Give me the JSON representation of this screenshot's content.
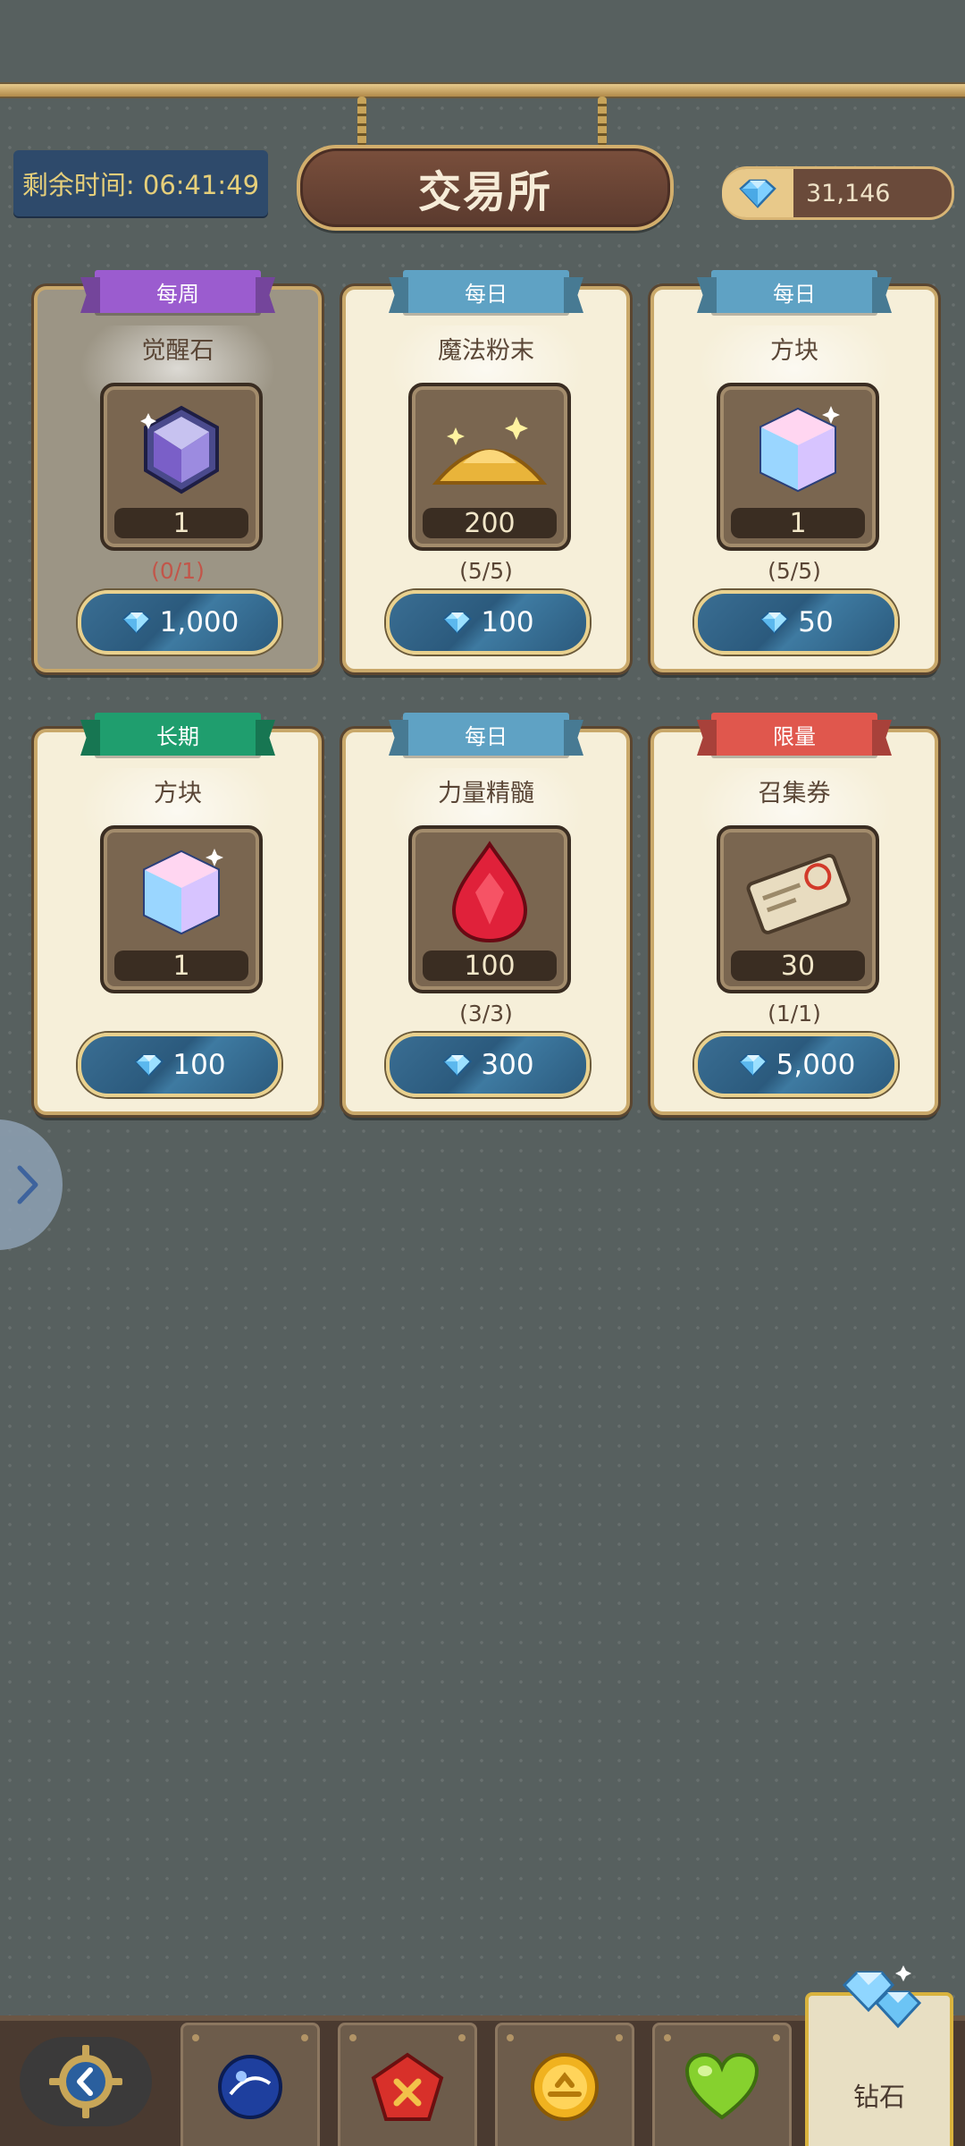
{
  "header": {
    "timer_text": "剩余时间: 06:41:49",
    "title": "交易所",
    "currency_value": "31,146",
    "currency_icon": "diamond-icon"
  },
  "colors": {
    "ribbon_weekly": "#9b5ccf",
    "ribbon_daily": "#5fa2c4",
    "ribbon_long": "#1f9e6e",
    "ribbon_limited": "#e0574d"
  },
  "cards": [
    {
      "ribbon": "每周",
      "ribbon_color": "#9b5ccf",
      "name": "觉醒石",
      "qty": "1",
      "limit": "(0/1)",
      "price": "1,000",
      "icon": "awakening-stone-icon",
      "sold_out": true
    },
    {
      "ribbon": "每日",
      "ribbon_color": "#5fa2c4",
      "name": "魔法粉末",
      "qty": "200",
      "limit": "(5/5)",
      "price": "100",
      "icon": "magic-powder-icon"
    },
    {
      "ribbon": "每日",
      "ribbon_color": "#5fa2c4",
      "name": "方块",
      "qty": "1",
      "limit": "(5/5)",
      "price": "50",
      "icon": "cube-icon"
    },
    {
      "ribbon": "长期",
      "ribbon_color": "#1f9e6e",
      "name": "方块",
      "qty": "1",
      "limit": "",
      "price": "100",
      "icon": "cube-icon"
    },
    {
      "ribbon": "每日",
      "ribbon_color": "#5fa2c4",
      "name": "力量精髓",
      "qty": "100",
      "limit": "(3/3)",
      "price": "300",
      "icon": "power-essence-icon"
    },
    {
      "ribbon": "限量",
      "ribbon_color": "#e0574d",
      "name": "召集券",
      "qty": "30",
      "limit": "(1/1)",
      "price": "5,000",
      "icon": "summon-ticket-icon"
    }
  ],
  "bottom_nav": {
    "back_icon": "back-arrow-icon",
    "tabs": [
      {
        "icon": "blue-orb-icon"
      },
      {
        "icon": "red-gem-icon"
      },
      {
        "icon": "gold-coin-icon"
      },
      {
        "icon": "green-heart-icon"
      },
      {
        "icon": "diamonds-icon",
        "label": "钻石",
        "active": true
      }
    ]
  }
}
